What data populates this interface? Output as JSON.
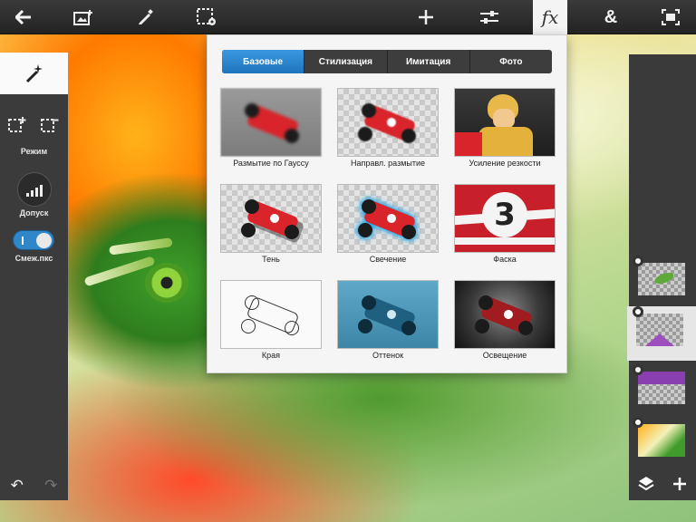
{
  "toolbar": {
    "icons": [
      "back-arrow-icon",
      "add-photo-icon",
      "brush-icon",
      "selection-settings-icon",
      "plus-icon",
      "adjustments-icon",
      "fx-icon",
      "ampersand-icon",
      "crop-icon"
    ],
    "fx_label": "fx",
    "ampersand_label": "&"
  },
  "left_panel": {
    "mode_label": "Режим",
    "tolerance_label": "Допуск",
    "contiguous_label": "Смеж.пкс",
    "contiguous_on": true
  },
  "fx_panel": {
    "tabs": [
      {
        "label": "Базовые",
        "active": true
      },
      {
        "label": "Стилизация",
        "active": false
      },
      {
        "label": "Имитация",
        "active": false
      },
      {
        "label": "Фото",
        "active": false
      }
    ],
    "effects": [
      {
        "label": "Размытие по Гауссу"
      },
      {
        "label": "Направл. размытие"
      },
      {
        "label": "Усиление резкости"
      },
      {
        "label": "Тень"
      },
      {
        "label": "Свечение"
      },
      {
        "label": "Фаска"
      },
      {
        "label": "Края"
      },
      {
        "label": "Оттенок"
      },
      {
        "label": "Освещение"
      }
    ]
  },
  "layers_panel": {
    "layer_count": 4,
    "selected_layer": 2
  },
  "colors": {
    "accent": "#2a86cf",
    "toolbar_bg": "#2b2b2b",
    "panel_bg": "#3b3b3b",
    "car_red": "#d8242a"
  }
}
